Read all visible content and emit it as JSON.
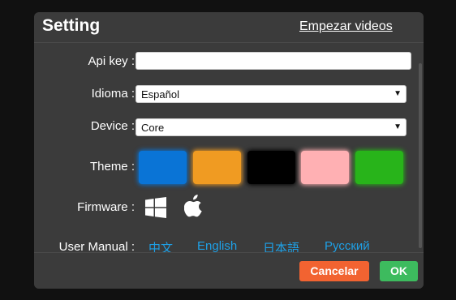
{
  "header": {
    "title": "Setting",
    "start_link": "Empezar videos"
  },
  "fields": {
    "api_key": {
      "label": "Api key :",
      "value": ""
    },
    "language": {
      "label": "Idioma :",
      "selected": "Español"
    },
    "device": {
      "label": "Device :",
      "selected": "Core"
    },
    "theme": {
      "label": "Theme :",
      "swatches": [
        "#0a74d6",
        "#f09b22",
        "#000000",
        "#ffb0b3",
        "#28b41a"
      ]
    },
    "firmware": {
      "label": "Firmware :",
      "icons": [
        "windows-icon",
        "apple-icon"
      ]
    },
    "user_manual": {
      "label": "User Manual :",
      "links": [
        "中文",
        "English",
        "日本語",
        "Русский"
      ]
    }
  },
  "footer": {
    "cancel": "Cancelar",
    "ok": "OK",
    "cancel_color": "#f26331",
    "ok_color": "#3dbb5e"
  },
  "colors": {
    "background": "#111111",
    "dialog": "#3b3b3b",
    "link": "#1ea0e6"
  }
}
